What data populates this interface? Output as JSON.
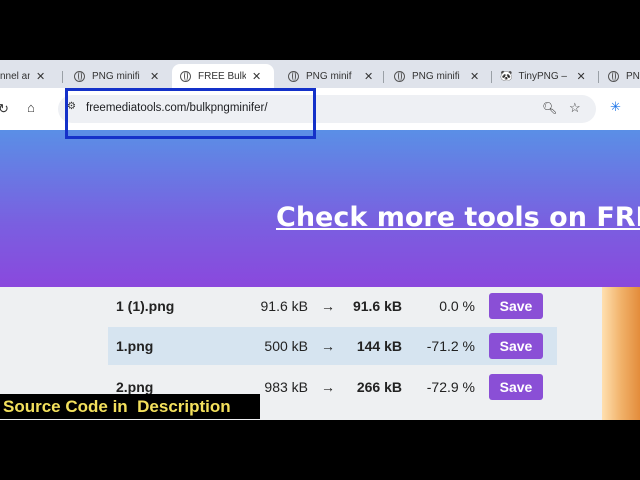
{
  "browser": {
    "tabs": [
      {
        "title": "nnel an"
      },
      {
        "title": "PNG minifi"
      },
      {
        "title": "FREE Bulk"
      },
      {
        "title": "PNG minif"
      },
      {
        "title": "PNG minifi"
      },
      {
        "title": "TinyPNG –"
      },
      {
        "title": "PNG"
      }
    ],
    "url": "freemediatools.com/bulkpngminifer/"
  },
  "banner": {
    "link_text": "Check more tools on FREE"
  },
  "files": [
    {
      "name": "1 (1).png",
      "original": "91.6 kB",
      "arrow": "→",
      "compressed": "91.6 kB",
      "change": "0.0 %",
      "save": "Save"
    },
    {
      "name": "1.png",
      "original": "500 kB",
      "arrow": "→",
      "compressed": "144 kB",
      "change": "-71.2 %",
      "save": "Save"
    },
    {
      "name": "2.png",
      "original": "983 kB",
      "arrow": "→",
      "compressed": "266 kB",
      "change": "-72.9 %",
      "save": "Save"
    }
  ],
  "caption": "Source Code in  Description",
  "colors": {
    "highlight": "#1431c9",
    "save_button": "#8a4fd6",
    "caption_text": "#f3e05c"
  }
}
